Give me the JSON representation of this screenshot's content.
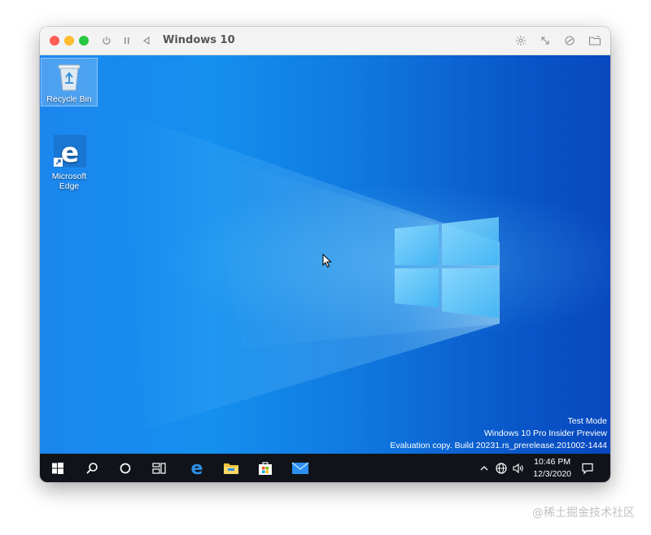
{
  "window": {
    "title": "Windows 10",
    "controls": {
      "close_color": "#ff5f57",
      "minimize_color": "#febc2e",
      "zoom_color": "#28c840",
      "left_icons": [
        "power-icon",
        "pause-icon",
        "back-icon"
      ],
      "right_icons": [
        "brightness-icon",
        "resize-icon",
        "coherence-icon",
        "folder-icon"
      ]
    }
  },
  "desktop": {
    "background_color": "#0f74dd",
    "icons": [
      {
        "label": "Recycle Bin",
        "icon": "recycle-bin-icon",
        "selected": true
      },
      {
        "label_line1": "Microsoft",
        "label_line2": "Edge",
        "icon": "edge-icon",
        "selected": false
      }
    ],
    "watermark": {
      "line1": "Test Mode",
      "line2": "Windows 10 Pro Insider Preview",
      "line3": "Evaluation copy. Build 20231.rs_prerelease.201002-1444"
    }
  },
  "taskbar": {
    "background_color": "#10141a",
    "buttons": [
      "start-icon",
      "search-icon",
      "cortana-icon",
      "task-view-icon",
      "edge-icon",
      "file-explorer-icon",
      "store-icon",
      "mail-icon"
    ],
    "tray": {
      "icons": [
        "chevron-up-icon",
        "network-icon",
        "volume-icon",
        "notification-icon"
      ],
      "time": "10:46 PM",
      "date": "12/3/2020"
    }
  },
  "footer": {
    "credit": "@稀土掘金技术社区"
  }
}
